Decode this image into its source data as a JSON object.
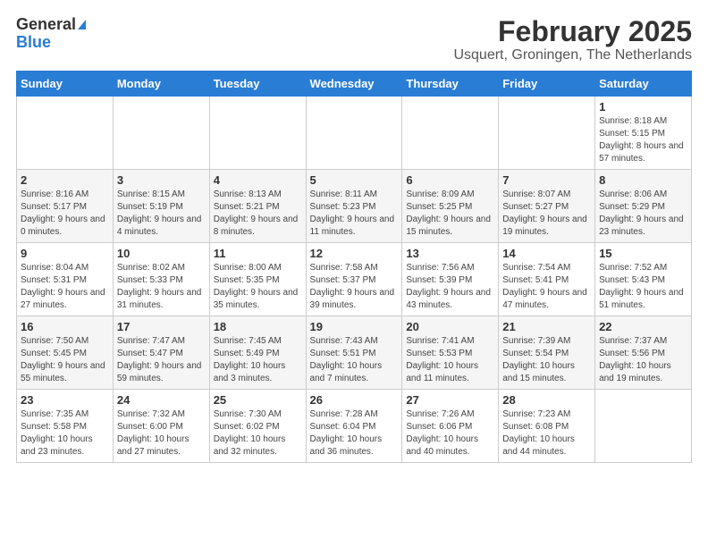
{
  "logo": {
    "general": "General",
    "blue": "Blue"
  },
  "title": "February 2025",
  "subtitle": "Usquert, Groningen, The Netherlands",
  "days_of_week": [
    "Sunday",
    "Monday",
    "Tuesday",
    "Wednesday",
    "Thursday",
    "Friday",
    "Saturday"
  ],
  "weeks": [
    [
      {
        "day": "",
        "info": ""
      },
      {
        "day": "",
        "info": ""
      },
      {
        "day": "",
        "info": ""
      },
      {
        "day": "",
        "info": ""
      },
      {
        "day": "",
        "info": ""
      },
      {
        "day": "",
        "info": ""
      },
      {
        "day": "1",
        "info": "Sunrise: 8:18 AM\nSunset: 5:15 PM\nDaylight: 8 hours and 57 minutes."
      }
    ],
    [
      {
        "day": "2",
        "info": "Sunrise: 8:16 AM\nSunset: 5:17 PM\nDaylight: 9 hours and 0 minutes."
      },
      {
        "day": "3",
        "info": "Sunrise: 8:15 AM\nSunset: 5:19 PM\nDaylight: 9 hours and 4 minutes."
      },
      {
        "day": "4",
        "info": "Sunrise: 8:13 AM\nSunset: 5:21 PM\nDaylight: 9 hours and 8 minutes."
      },
      {
        "day": "5",
        "info": "Sunrise: 8:11 AM\nSunset: 5:23 PM\nDaylight: 9 hours and 11 minutes."
      },
      {
        "day": "6",
        "info": "Sunrise: 8:09 AM\nSunset: 5:25 PM\nDaylight: 9 hours and 15 minutes."
      },
      {
        "day": "7",
        "info": "Sunrise: 8:07 AM\nSunset: 5:27 PM\nDaylight: 9 hours and 19 minutes."
      },
      {
        "day": "8",
        "info": "Sunrise: 8:06 AM\nSunset: 5:29 PM\nDaylight: 9 hours and 23 minutes."
      }
    ],
    [
      {
        "day": "9",
        "info": "Sunrise: 8:04 AM\nSunset: 5:31 PM\nDaylight: 9 hours and 27 minutes."
      },
      {
        "day": "10",
        "info": "Sunrise: 8:02 AM\nSunset: 5:33 PM\nDaylight: 9 hours and 31 minutes."
      },
      {
        "day": "11",
        "info": "Sunrise: 8:00 AM\nSunset: 5:35 PM\nDaylight: 9 hours and 35 minutes."
      },
      {
        "day": "12",
        "info": "Sunrise: 7:58 AM\nSunset: 5:37 PM\nDaylight: 9 hours and 39 minutes."
      },
      {
        "day": "13",
        "info": "Sunrise: 7:56 AM\nSunset: 5:39 PM\nDaylight: 9 hours and 43 minutes."
      },
      {
        "day": "14",
        "info": "Sunrise: 7:54 AM\nSunset: 5:41 PM\nDaylight: 9 hours and 47 minutes."
      },
      {
        "day": "15",
        "info": "Sunrise: 7:52 AM\nSunset: 5:43 PM\nDaylight: 9 hours and 51 minutes."
      }
    ],
    [
      {
        "day": "16",
        "info": "Sunrise: 7:50 AM\nSunset: 5:45 PM\nDaylight: 9 hours and 55 minutes."
      },
      {
        "day": "17",
        "info": "Sunrise: 7:47 AM\nSunset: 5:47 PM\nDaylight: 9 hours and 59 minutes."
      },
      {
        "day": "18",
        "info": "Sunrise: 7:45 AM\nSunset: 5:49 PM\nDaylight: 10 hours and 3 minutes."
      },
      {
        "day": "19",
        "info": "Sunrise: 7:43 AM\nSunset: 5:51 PM\nDaylight: 10 hours and 7 minutes."
      },
      {
        "day": "20",
        "info": "Sunrise: 7:41 AM\nSunset: 5:53 PM\nDaylight: 10 hours and 11 minutes."
      },
      {
        "day": "21",
        "info": "Sunrise: 7:39 AM\nSunset: 5:54 PM\nDaylight: 10 hours and 15 minutes."
      },
      {
        "day": "22",
        "info": "Sunrise: 7:37 AM\nSunset: 5:56 PM\nDaylight: 10 hours and 19 minutes."
      }
    ],
    [
      {
        "day": "23",
        "info": "Sunrise: 7:35 AM\nSunset: 5:58 PM\nDaylight: 10 hours and 23 minutes."
      },
      {
        "day": "24",
        "info": "Sunrise: 7:32 AM\nSunset: 6:00 PM\nDaylight: 10 hours and 27 minutes."
      },
      {
        "day": "25",
        "info": "Sunrise: 7:30 AM\nSunset: 6:02 PM\nDaylight: 10 hours and 32 minutes."
      },
      {
        "day": "26",
        "info": "Sunrise: 7:28 AM\nSunset: 6:04 PM\nDaylight: 10 hours and 36 minutes."
      },
      {
        "day": "27",
        "info": "Sunrise: 7:26 AM\nSunset: 6:06 PM\nDaylight: 10 hours and 40 minutes."
      },
      {
        "day": "28",
        "info": "Sunrise: 7:23 AM\nSunset: 6:08 PM\nDaylight: 10 hours and 44 minutes."
      },
      {
        "day": "",
        "info": ""
      }
    ]
  ]
}
